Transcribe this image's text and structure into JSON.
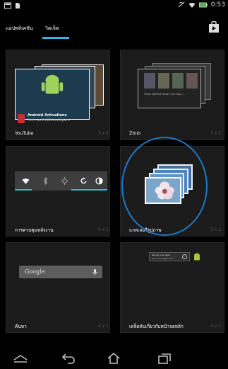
{
  "status_bar": {
    "time": "0:53",
    "icons": [
      "gallery-icon",
      "document-icon",
      "no-sync-icon",
      "wifi-icon",
      "battery-icon"
    ]
  },
  "tabs": [
    {
      "label": "แอปพลิเคชัน",
      "selected": false
    },
    {
      "label": "วิดเจ็ต",
      "selected": true
    }
  ],
  "accent_color": "#33b5e5",
  "widgets": [
    {
      "label": "YouTube",
      "size": "3 x 2",
      "caption_line1": "Android Activations",
      "caption_line2": "from androiddevelopers"
    },
    {
      "label": "Zinio",
      "size": "3 x 2",
      "caption": "Travel Defend Mode? The Glan..."
    },
    {
      "label": "การควบคุมพลังงาน",
      "size": "4 x 1"
    },
    {
      "label": "แกลเลอรีรูปภาพ",
      "size": "3 x 3"
    },
    {
      "label": "ค้นหา",
      "size": "4 x 1",
      "search_text": "Google"
    },
    {
      "label": "เคล็ดลับเกี่ยวกับหน้าจอหลัก",
      "size": "4 x 2",
      "tip_title": "See all your apps",
      "tip_text": "Touch the Apps icon."
    }
  ],
  "nav": [
    "back-icon",
    "home-icon",
    "recent-apps-icon",
    "menu-icon"
  ]
}
